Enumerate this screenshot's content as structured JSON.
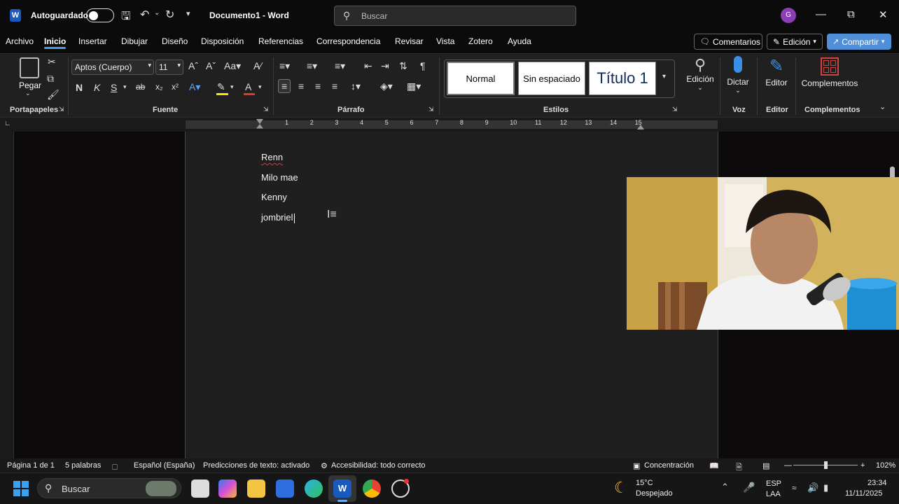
{
  "titlebar": {
    "autosave_label": "Autoguardado",
    "doc_title": "Documento1  -  Word",
    "search_placeholder": "Buscar",
    "avatar_initial": "G",
    "app_icon": "W"
  },
  "menu": {
    "items": [
      "Archivo",
      "Inicio",
      "Insertar",
      "Dibujar",
      "Diseño",
      "Disposición",
      "Referencias",
      "Correspondencia",
      "Revisar",
      "Vista",
      "Zotero",
      "Ayuda"
    ],
    "active": "Inicio",
    "comments_label": "Comentarios",
    "edit_mode_label": "Edición",
    "share_label": "Compartir"
  },
  "ribbon": {
    "paste_label": "Pegar",
    "font_name": "Aptos (Cuerpo)",
    "font_size": "11",
    "bold": "N",
    "italic": "K",
    "underline": "S",
    "styles": [
      "Normal",
      "Sin espaciado",
      "Título 1"
    ],
    "edicion_label": "Edición",
    "dictar_label": "Dictar",
    "editor_label": "Editor",
    "complementos_label": "Complementos",
    "groups": {
      "portapapeles": "Portapapeles",
      "fuente": "Fuente",
      "parrafo": "Párrafo",
      "estilos": "Estilos",
      "voz": "Voz",
      "editor": "Editor",
      "complementos": "Complementos"
    }
  },
  "ruler": {
    "numbers": [
      "1",
      "2",
      "3",
      "4",
      "5",
      "6",
      "7",
      "8",
      "9",
      "10",
      "11",
      "12",
      "13",
      "14",
      "15"
    ]
  },
  "document": {
    "lines": [
      "Renn",
      "Milo mae",
      "Kenny",
      "jombriel"
    ]
  },
  "statusbar": {
    "page": "Página 1 de 1",
    "words": "5 palabras",
    "language": "Español (España)",
    "predictions": "Predicciones de texto: activado",
    "accessibility": "Accesibilidad: todo correcto",
    "focus": "Concentración",
    "zoom": "102%"
  },
  "taskbar": {
    "search_label": "Buscar",
    "weather_temp": "15°C",
    "weather_desc": "Despejado",
    "lang1": "ESP",
    "lang2": "LAA",
    "time": "23:34",
    "date": "11/11/2025"
  },
  "colors": {
    "accent": "#4e9be8",
    "word_blue": "#185abd",
    "share_bg": "#4f8fd8"
  }
}
